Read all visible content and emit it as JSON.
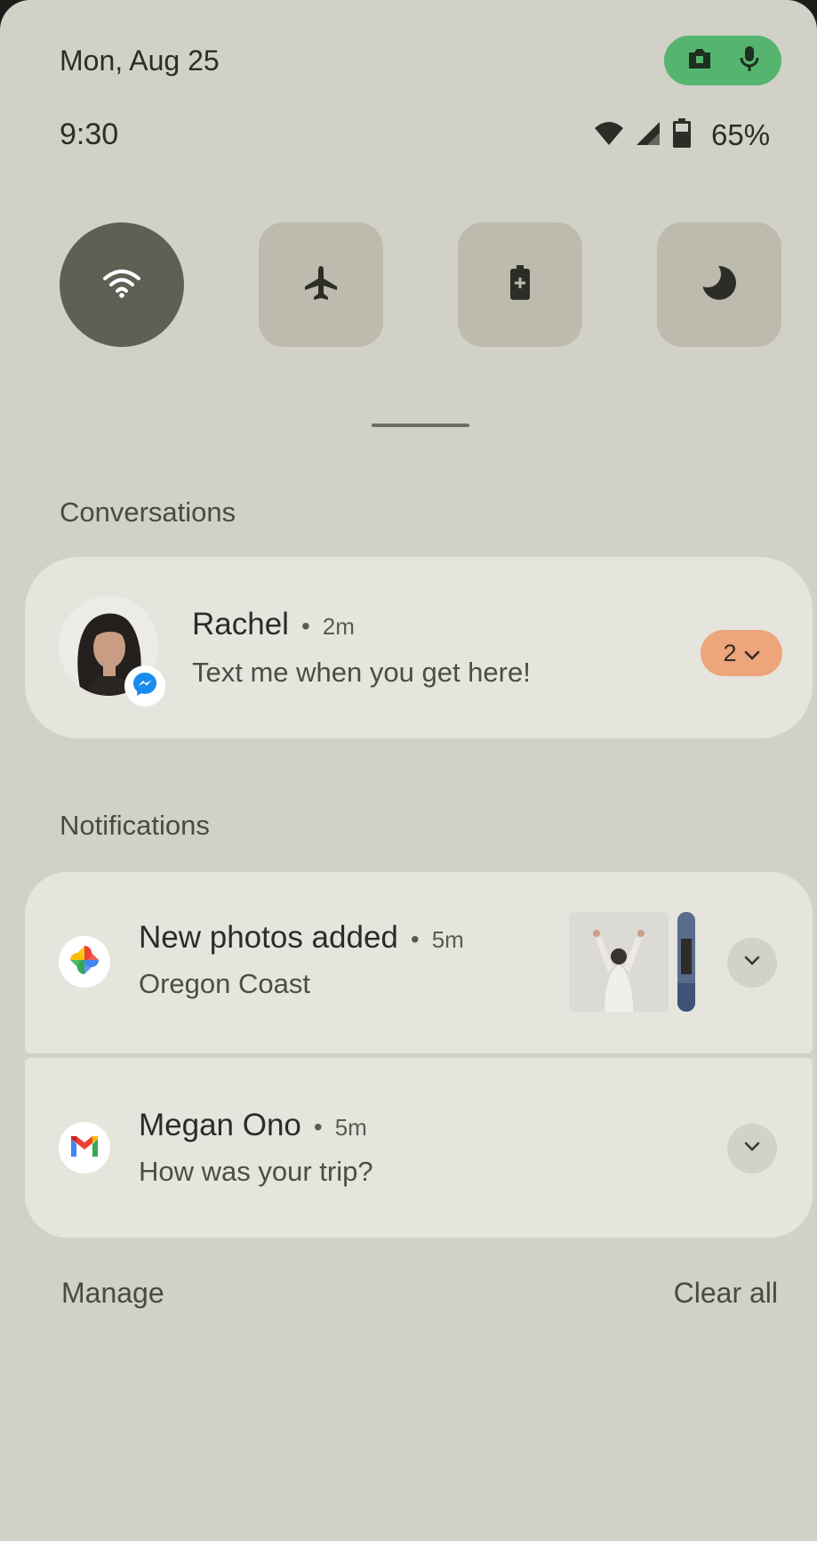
{
  "status_bar": {
    "date": "Mon, Aug 25",
    "time": "9:30",
    "battery_percent": "65%",
    "icons": [
      "camera-icon",
      "microphone-icon",
      "wifi-icon",
      "cellular-signal-icon",
      "battery-icon"
    ],
    "privacy_chip_color": "#55b56f"
  },
  "quick_settings": [
    {
      "name": "wifi",
      "icon": "wifi-icon",
      "active": true
    },
    {
      "name": "airplane-mode",
      "icon": "airplane-icon",
      "active": false
    },
    {
      "name": "battery-saver",
      "icon": "battery-saver-icon",
      "active": false
    },
    {
      "name": "dark-theme",
      "icon": "moon-icon",
      "active": false
    }
  ],
  "conversations": {
    "heading": "Conversations",
    "items": [
      {
        "sender": "Rachel",
        "time": "2m",
        "message": "Text me when you get here!",
        "count": "2",
        "app_icon": "messenger-icon"
      }
    ]
  },
  "notifications": {
    "heading": "Notifications",
    "items": [
      {
        "title": "New photos added",
        "time": "5m",
        "text": "Oregon Coast",
        "app_icon": "google-photos-icon"
      },
      {
        "title": "Megan Ono",
        "time": "5m",
        "text": "How was your trip?",
        "app_icon": "gmail-icon"
      }
    ]
  },
  "footer": {
    "manage": "Manage",
    "clear_all": "Clear all"
  },
  "colors": {
    "shade_background": "#d2d1c8",
    "card_background": "#e6e5dd",
    "active_tile": "#605f54",
    "inactive_tile": "#bdbbae",
    "count_pill": "#eda57c"
  }
}
